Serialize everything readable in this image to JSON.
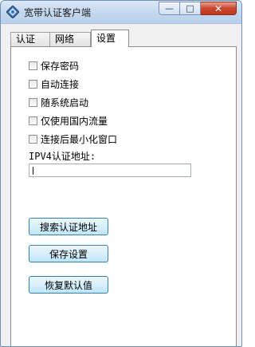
{
  "window": {
    "title": "宽带认证客户端"
  },
  "titlebar": {
    "min_glyph": "—",
    "max_glyph": "□",
    "close_glyph": "✕"
  },
  "tabs": [
    {
      "label": "认证"
    },
    {
      "label": "网络"
    },
    {
      "label": "设置",
      "active": true
    }
  ],
  "settings": {
    "options": [
      {
        "label": "保存密码",
        "checked": false
      },
      {
        "label": "自动连接",
        "checked": false
      },
      {
        "label": "随系统启动",
        "checked": false
      },
      {
        "label": "仅使用国内流量",
        "checked": false
      },
      {
        "label": "连接后最小化窗口",
        "checked": false
      }
    ],
    "ipv4_label": "IPV4认证地址:",
    "ipv4_value": ""
  },
  "buttons": {
    "search": "搜索认证地址",
    "save": "保存设置",
    "restore": "恢复默认值"
  },
  "icons": {
    "app": "app-diamond-icon"
  },
  "colors": {
    "title_gradient_top": "#dce9f7",
    "close_red": "#c9452c",
    "button_border": "#3c7fb1"
  }
}
